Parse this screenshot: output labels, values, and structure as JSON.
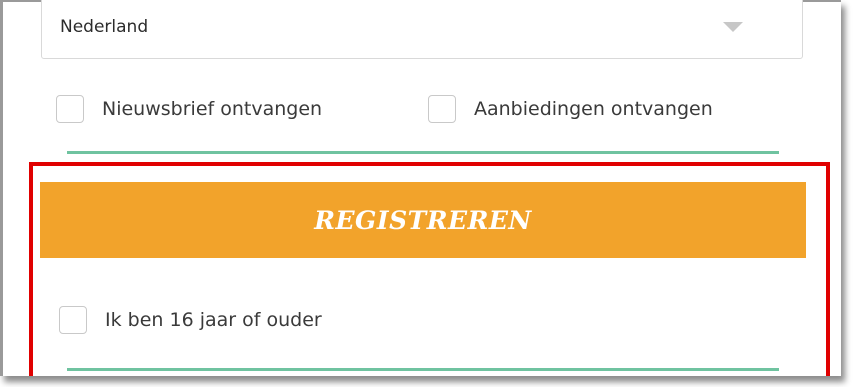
{
  "country_select": {
    "selected": "Nederland"
  },
  "newsletter": {
    "label": "Nieuwsbrief ontvangen"
  },
  "offers": {
    "label": "Aanbiedingen ontvangen"
  },
  "register_button": {
    "label": "REGISTREREN"
  },
  "age_confirm": {
    "label": "Ik ben 16 jaar of ouder"
  },
  "colors": {
    "button": "#f2a32b",
    "highlight": "#e00000",
    "divider": "#6fc3a0"
  }
}
